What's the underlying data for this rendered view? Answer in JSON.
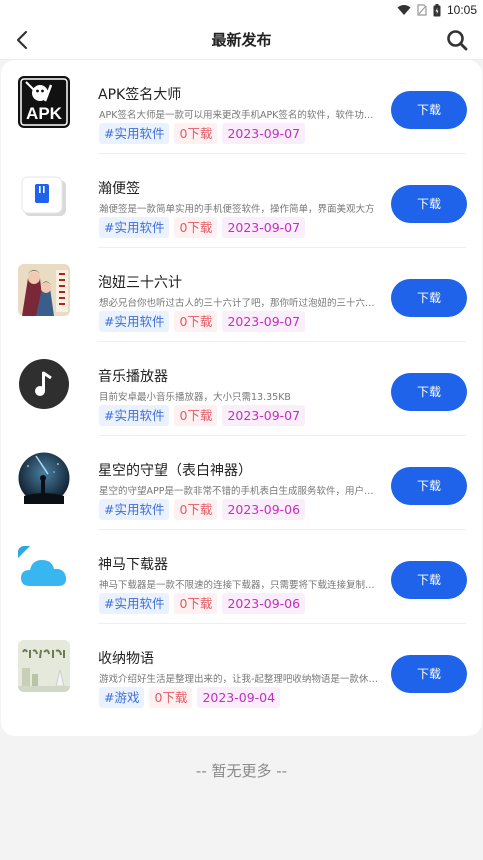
{
  "status_bar": {
    "time": "10:05",
    "icons": [
      "wifi-icon",
      "sim-icon",
      "battery-icon"
    ]
  },
  "header": {
    "title": "最新发布",
    "back_icon": "chevron-left-icon",
    "search_icon": "search-icon"
  },
  "apps": [
    {
      "name": "APK签名大师",
      "desc": "APK签名大师是一款可以用来更改手机APK签名的软件，软件功能强大",
      "category": "#实用软件",
      "downloads": "0下载",
      "date": "2023-09-07",
      "button": "下载",
      "icon_label": "APK",
      "icon": "apk-signer-icon"
    },
    {
      "name": "瀚便签",
      "desc": "瀚便签是一款简单实用的手机便签软件，操作简单，界面美观大方",
      "category": "#实用软件",
      "downloads": "0下载",
      "date": "2023-09-07",
      "button": "下载",
      "icon": "notepad-icon"
    },
    {
      "name": "泡妞三十六计",
      "desc": "想必兄台你也听过古人的三十六计了吧，那你听过泡妞的三十六计吗",
      "category": "#实用软件",
      "downloads": "0下载",
      "date": "2023-09-07",
      "button": "下载",
      "icon": "book-cover-icon"
    },
    {
      "name": "音乐播放器",
      "desc": "目前安卓最小音乐播放器，大小只需13.35KB",
      "category": "#实用软件",
      "downloads": "0下载",
      "date": "2023-09-07",
      "button": "下载",
      "icon": "music-note-icon"
    },
    {
      "name": "星空的守望（表白神器）",
      "desc": "星空的守望APP是一款非常不错的手机表白生成服务软件，用户可以使用",
      "category": "#实用软件",
      "downloads": "0下载",
      "date": "2023-09-06",
      "button": "下载",
      "icon": "starry-sky-icon"
    },
    {
      "name": "神马下载器",
      "desc": "神马下载器是一款不限速的连接下载器，只需要将下载连接复制进去即可",
      "category": "#实用软件",
      "downloads": "0下载",
      "date": "2023-09-06",
      "button": "下载",
      "icon": "cloud-icon"
    },
    {
      "name": "收纳物语",
      "desc": "游戏介绍好生活是整理出来的，让我-起整理吧收纳物语是一款休闲游戏",
      "category": "#游戏",
      "downloads": "0下载",
      "date": "2023-09-04",
      "button": "下载",
      "icon": "storage-story-icon"
    }
  ],
  "footer": {
    "text": "-- 暂无更多 --"
  },
  "colors": {
    "primary": "#1e63e9",
    "category_tag": "#3f6fd8",
    "download_tag": "#e25b66",
    "date_tag": "#c12fbf"
  }
}
